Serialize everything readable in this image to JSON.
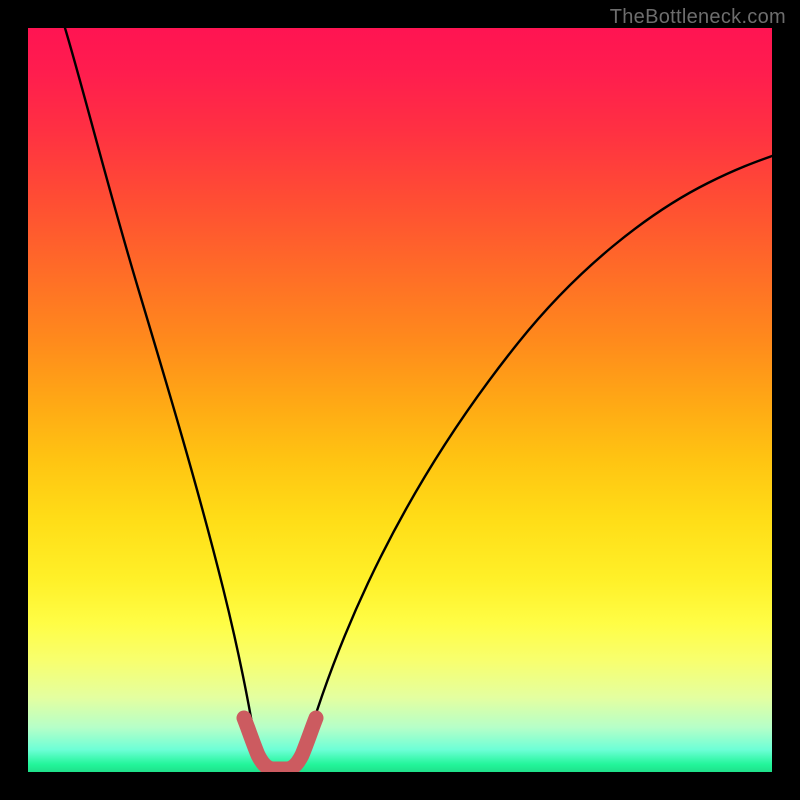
{
  "watermark": "TheBottleneck.com",
  "chart_data": {
    "type": "line",
    "title": "",
    "xlabel": "",
    "ylabel": "",
    "xlim": [
      0,
      100
    ],
    "ylim": [
      0,
      100
    ],
    "series": [
      {
        "name": "bottleneck-curve-left",
        "x": [
          5,
          8,
          11,
          14,
          17,
          20,
          23,
          25,
          27,
          28.5,
          29.5,
          30
        ],
        "values": [
          100,
          88,
          76,
          64,
          52,
          40,
          28,
          18,
          10,
          5,
          2.2,
          0.8
        ]
      },
      {
        "name": "bottleneck-curve-right",
        "x": [
          36,
          37,
          39,
          42,
          46,
          51,
          57,
          64,
          72,
          81,
          90,
          100
        ],
        "values": [
          0.8,
          2.5,
          6,
          12,
          20,
          29,
          38,
          48,
          58,
          67,
          75,
          82
        ]
      },
      {
        "name": "optimum-band",
        "x": [
          29,
          30,
          31,
          32,
          33,
          34,
          35,
          36,
          37
        ],
        "values": [
          6.5,
          2.2,
          0.8,
          0.5,
          0.5,
          0.5,
          0.8,
          2.2,
          6.5
        ]
      }
    ],
    "colors": {
      "curve": "#000000",
      "optimum_band": "#cc5b60",
      "gradient_top": "#ff1452",
      "gradient_bottom": "#1fe08a"
    }
  }
}
